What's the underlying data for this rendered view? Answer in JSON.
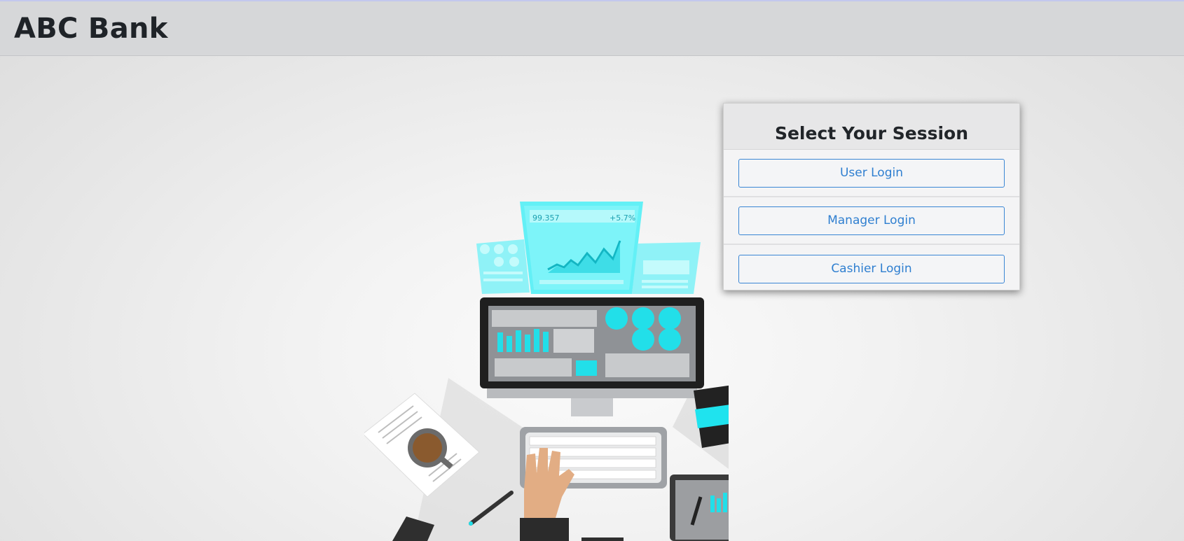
{
  "header": {
    "brand": "ABC Bank"
  },
  "session_card": {
    "title": "Select Your Session",
    "buttons": [
      {
        "label": "User Login"
      },
      {
        "label": "Manager Login"
      },
      {
        "label": "Cashier Login"
      }
    ]
  },
  "illustration": {
    "chart_value": "99.357",
    "chart_change": "+5.7%",
    "colors": {
      "accent": "#1fe3ee",
      "dark": "#2b2b2b",
      "skin": "#e2ad84",
      "coffee": "#8a5a2e"
    }
  }
}
